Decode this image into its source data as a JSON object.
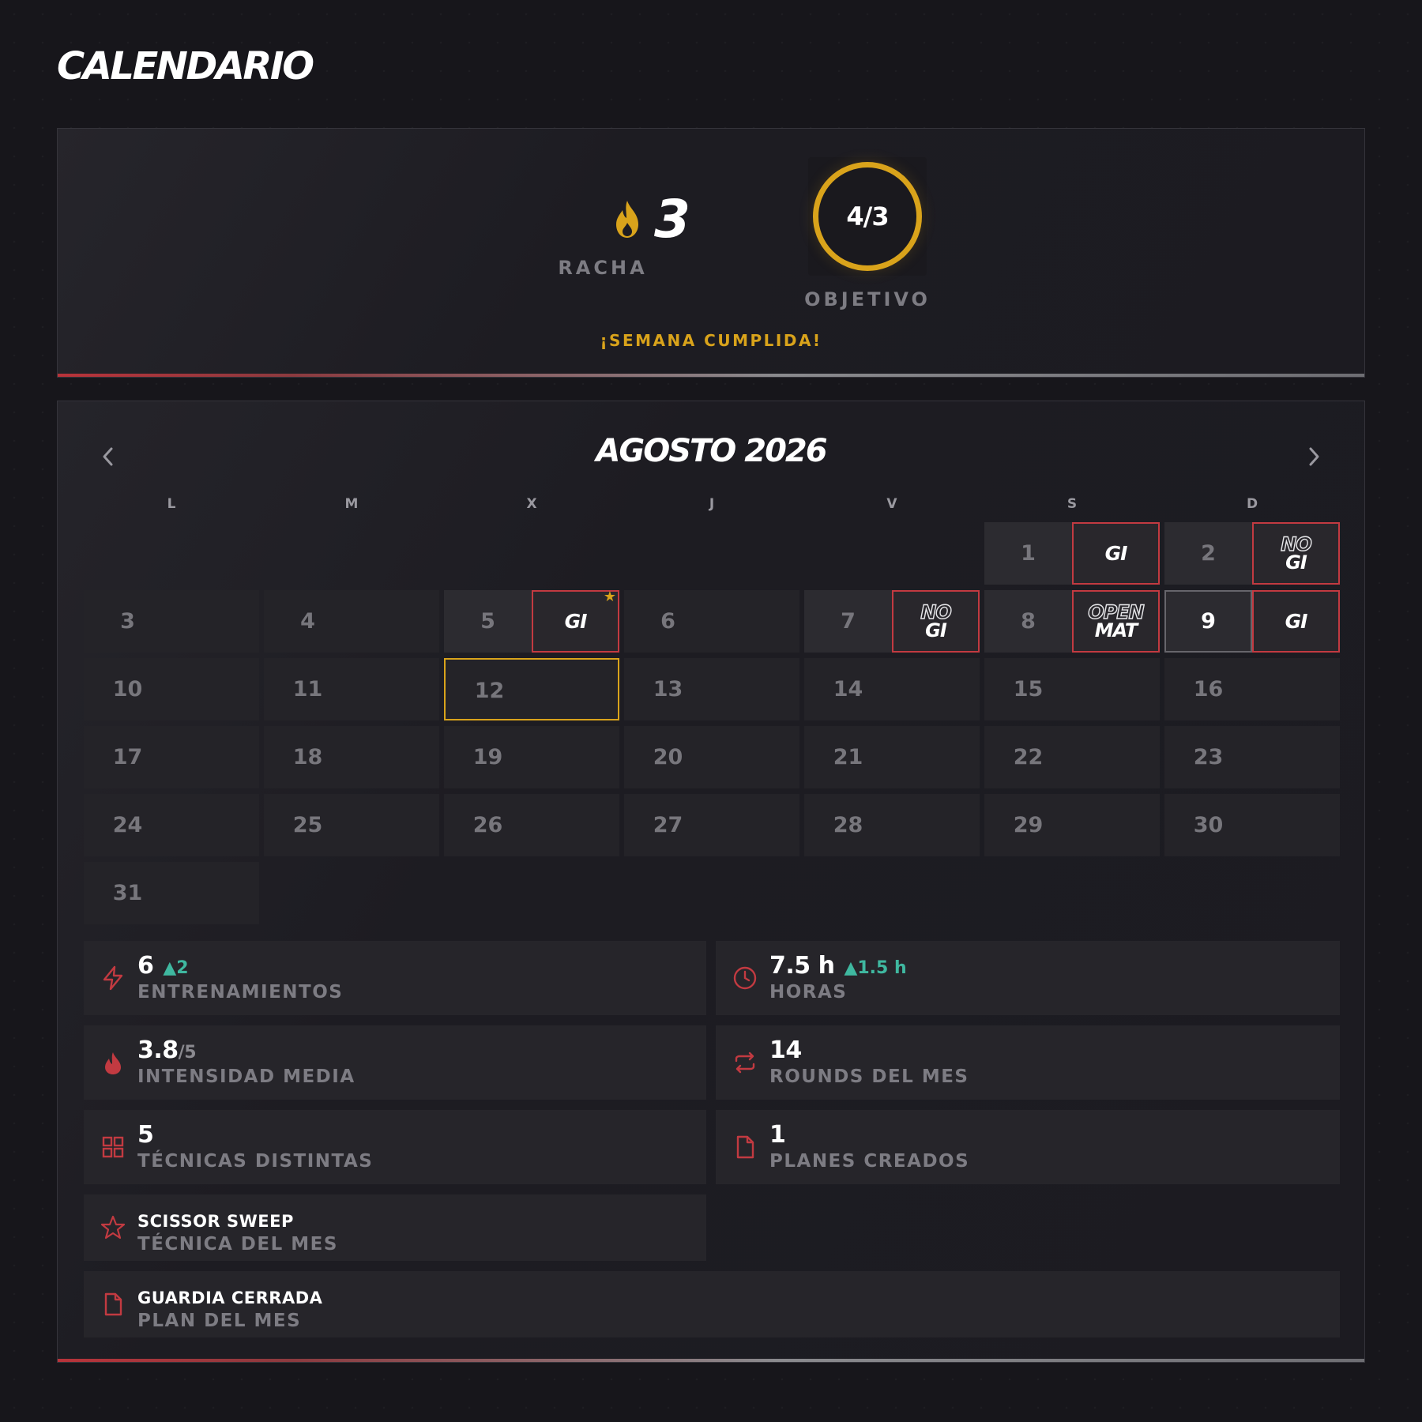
{
  "page": {
    "title": "CALENDARIO"
  },
  "streak": {
    "value": "3",
    "label": "RACHA",
    "goal_value": "4/3",
    "goal_label": "OBJETIVO",
    "week_message": "¡SEMANA CUMPLIDA!",
    "goal_progress": 1.0
  },
  "calendar": {
    "month_title": "AGOSTO 2026",
    "prev_icon": "chevron-left-icon",
    "next_icon": "chevron-right-icon",
    "weekdays": [
      "L",
      "M",
      "X",
      "J",
      "V",
      "S",
      "D"
    ],
    "days": [
      {
        "d": "1",
        "tag": [
          "GI"
        ]
      },
      {
        "d": "2",
        "tag": [
          "NO",
          "GI"
        ]
      },
      {
        "d": "3"
      },
      {
        "d": "4"
      },
      {
        "d": "5",
        "tag": [
          "GI"
        ],
        "starred": true
      },
      {
        "d": "6"
      },
      {
        "d": "7",
        "tag": [
          "NO",
          "GI"
        ]
      },
      {
        "d": "8",
        "tag": [
          "OPEN",
          "MAT"
        ]
      },
      {
        "d": "9",
        "tag": [
          "GI"
        ],
        "selected": true
      },
      {
        "d": "10"
      },
      {
        "d": "11"
      },
      {
        "d": "12",
        "today": true
      },
      {
        "d": "13"
      },
      {
        "d": "14"
      },
      {
        "d": "15"
      },
      {
        "d": "16"
      },
      {
        "d": "17"
      },
      {
        "d": "18"
      },
      {
        "d": "19"
      },
      {
        "d": "20"
      },
      {
        "d": "21"
      },
      {
        "d": "22"
      },
      {
        "d": "23"
      },
      {
        "d": "24"
      },
      {
        "d": "25"
      },
      {
        "d": "26"
      },
      {
        "d": "27"
      },
      {
        "d": "28"
      },
      {
        "d": "29"
      },
      {
        "d": "30"
      },
      {
        "d": "31"
      }
    ],
    "first_weekday_index": 5
  },
  "stats": {
    "trainings": {
      "value": "6",
      "delta": "▲2",
      "label": "ENTRENAMIENTOS",
      "icon": "lightning-icon"
    },
    "hours": {
      "value": "7.5 h",
      "delta": "▲1.5 h",
      "label": "HORAS",
      "icon": "clock-icon"
    },
    "intensity": {
      "value": "3.8",
      "sub": "/5",
      "label": "INTENSIDAD MEDIA",
      "icon": "flame-icon"
    },
    "rounds": {
      "value": "14",
      "label": "ROUNDS DEL MES",
      "icon": "repeat-icon"
    },
    "techniques": {
      "value": "5",
      "label": "TÉCNICAS DISTINTAS",
      "icon": "grid-icon"
    },
    "plans": {
      "value": "1",
      "label": "PLANES CREADOS",
      "icon": "document-icon"
    },
    "technique_of_month": {
      "value": "SCISSOR SWEEP",
      "label": "TÉCNICA DEL MES",
      "icon": "star-icon"
    },
    "plan_of_month": {
      "value": "GUARDIA CERRADA",
      "label": "PLAN DEL MES",
      "icon": "document-icon"
    }
  },
  "colors": {
    "accent_red": "#c23a41",
    "accent_gold": "#d9a31b",
    "delta_green": "#3fb8a0",
    "background": "#17161b"
  }
}
